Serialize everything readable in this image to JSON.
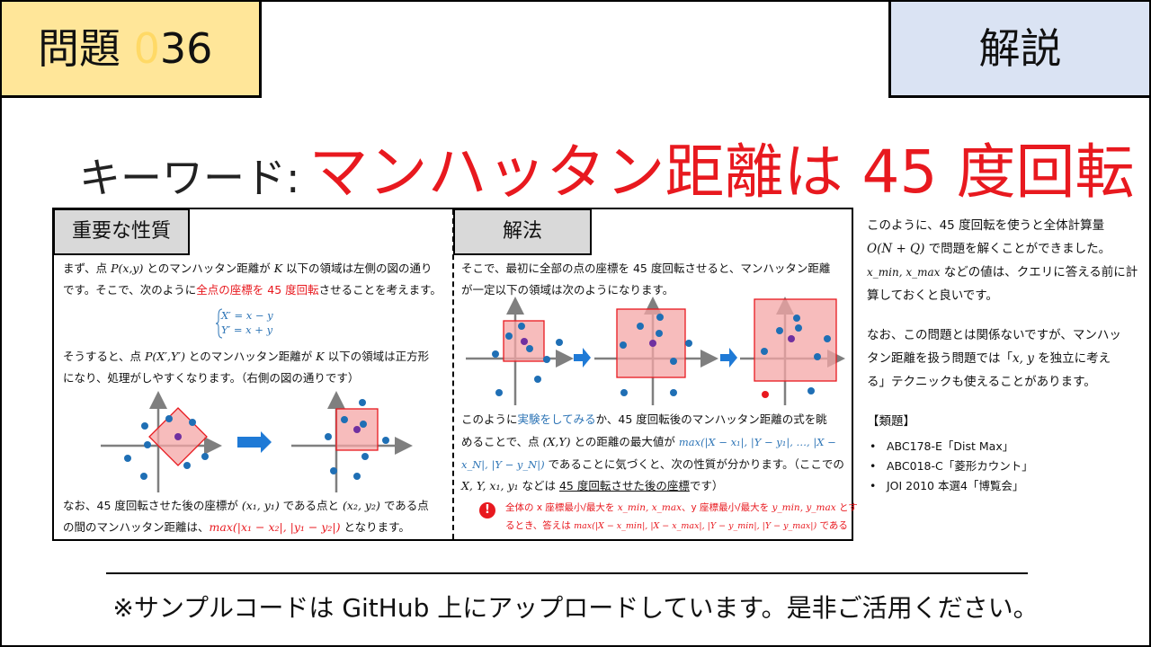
{
  "header": {
    "problem_label": "問題",
    "problem_number_faded": "0",
    "problem_number": "36",
    "kaisetsu": "解説"
  },
  "keyword": {
    "label": "キーワード:",
    "title": "マンハッタン距離は 45 度回転"
  },
  "left_section": {
    "tag": "重要な性質",
    "p1_a": "まず、点 ",
    "p1_point": "P(x,y)",
    "p1_b": " とのマンハッタン距離が ",
    "p1_k": "K",
    "p1_c": " 以下の領域は左側の図の通り",
    "p2_a": "です。そこで、次のように",
    "p2_red": "全点の座標を 45 度回転",
    "p2_b": "させることを考えます。",
    "eq1": "X′ = x − y",
    "eq2": "Y′ = x + y",
    "p3_a": "そうすると、点 ",
    "p3_point": "P(X′,Y′)",
    "p3_b": " とのマンハッタン距離が ",
    "p3_k": "K",
    "p3_c": " 以下の領域は正方形",
    "p4": "になり、処理がしやすくなります。（右側の図の通りです）",
    "p5_a": "なお、45 度回転させた後の座標が ",
    "p5_m1": "(x₁, y₁)",
    "p5_b": " である点と ",
    "p5_m2": "(x₂, y₂)",
    "p5_c": " である点",
    "p6_a": "の間のマンハッタン距離は、",
    "p6_red": "max(|x₁ − x₂|, |y₁ − y₂|)",
    "p6_b": " となります。"
  },
  "right_section": {
    "tag": "解法",
    "p1": "そこで、最初に全部の点の座標を 45 度回転させると、マンハッタン距離",
    "p2": "が一定以下の領域は次のようになります。",
    "p3_a": "このように",
    "p3_blue": "実験をしてみる",
    "p3_b": "か、45 度回転後のマンハッタン距離の式を眺",
    "p4_a": "めることで、点 ",
    "p4_m": "(X,Y)",
    "p4_b": " との距離の最大値が ",
    "p4_blue": "max(|X − x₁|, |Y − y₁|, …, |X −",
    "p5_blue": "x_N|, |Y − y_N|)",
    "p5_b": " であることに気づくと、次の性質が分かります。（ここでの",
    "p6_m": "X, Y, x₁, y₁",
    "p6_a": " などは ",
    "p6_under": "45 度回転させた後の座標",
    "p6_b": "です）",
    "warn_icon": "!",
    "w1_a": "全体の x 座標最小/最大を ",
    "w1_m1": "x_min, x_max",
    "w1_b": "、y 座標最小/最大を ",
    "w1_m2": "y_min, y_max",
    "w1_c": " とす",
    "w2_a": "るとき、答えは ",
    "w2_m": "max(|X − x_min|, |X − x_max|, |Y − y_min|, |Y − y_max|)",
    "w2_b": " である"
  },
  "sidebar": {
    "s1": "このように、45 度回転を使うと全体計算量",
    "s2_m": "O(N + Q)",
    "s2": " で問題を解くことができました。",
    "s3_m": "x_min, x_max",
    "s3": " などの値は、クエリに答える前に計",
    "s4": "算しておくと良いです。",
    "s5": "なお、この問題とは関係ないですが、マンハッ",
    "s6_a": "タン距離を扱う問題では「",
    "s6_m": "x, y",
    "s6_b": " を独立に考え",
    "s7": "る」テクニックも使えることがあります。",
    "related_title": "【類題】",
    "related": [
      "ABC178-E「Dist Max」",
      "ABC018-C「菱形カウント」",
      "JOI 2010 本選4「博覧会」"
    ]
  },
  "footer": {
    "note": "※サンプルコードは GitHub 上にアップロードしています。是非ご活用ください。"
  },
  "colors": {
    "problem_bg": "#ffe699",
    "kaisetsu_bg": "#dae3f3",
    "accent_red": "#e8191f",
    "accent_blue": "#2e75b6",
    "point_blue": "#1f6fb5",
    "point_purple": "#7030a0",
    "region_fill": "#f4a6a6",
    "arrow_blue": "#1f7ad6"
  }
}
